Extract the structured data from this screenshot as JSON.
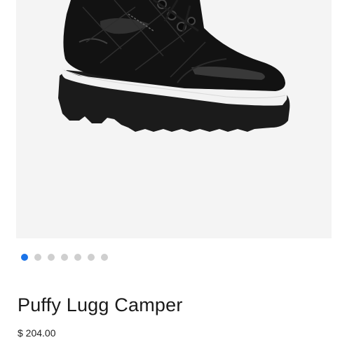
{
  "product": {
    "name": "Puffy Lugg Camper",
    "price": "$ 204.00",
    "image_alt": "Black quilted puffy lace-up boot with lug sole"
  },
  "gallery": {
    "slide_count": 7,
    "active_index": 0
  },
  "colors": {
    "active_dot": "#1a73e8",
    "inactive_dot": "#cfcfcf",
    "image_bg": "#f4f4f4"
  }
}
